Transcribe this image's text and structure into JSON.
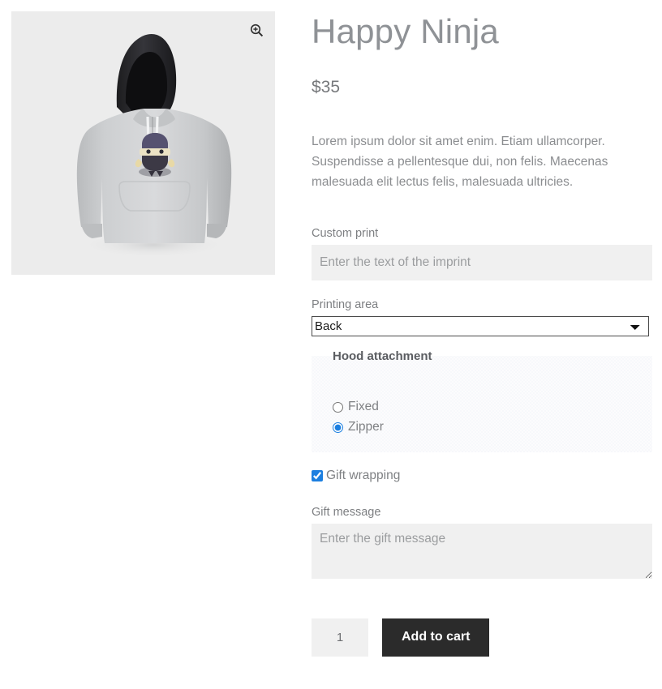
{
  "product": {
    "title": "Happy Ninja",
    "price": "$35",
    "description": "Lorem ipsum dolor sit amet enim. Etiam ullamcorper. Suspendisse a pellentesque dui, non felis. Maecenas malesuada elit lectus felis, malesuada ultricies.",
    "image_alt": "gray hoodie with black hood and ninja character print"
  },
  "gallery": {
    "zoom_icon": "zoom-in-icon"
  },
  "form": {
    "custom_print": {
      "label": "Custom print",
      "value": "",
      "placeholder": "Enter the text of the imprint"
    },
    "printing_area": {
      "label": "Printing area",
      "selected": "Back",
      "options": [
        "Back"
      ]
    },
    "hood_attachment": {
      "legend": "Hood attachment",
      "options": [
        {
          "label": "Fixed",
          "checked": false
        },
        {
          "label": "Zipper",
          "checked": true
        }
      ]
    },
    "gift_wrapping": {
      "label": "Gift wrapping",
      "checked": true
    },
    "gift_message": {
      "label": "Gift message",
      "value": "",
      "placeholder": "Enter the gift message"
    },
    "quantity": {
      "value": "1"
    },
    "add_to_cart_label": "Add to cart"
  },
  "colors": {
    "accent": "#1c7fe0",
    "button_bg": "#2b2b2b",
    "input_bg": "#f0f0f0",
    "gallery_bg": "#ececec",
    "title": "#8f9296"
  }
}
